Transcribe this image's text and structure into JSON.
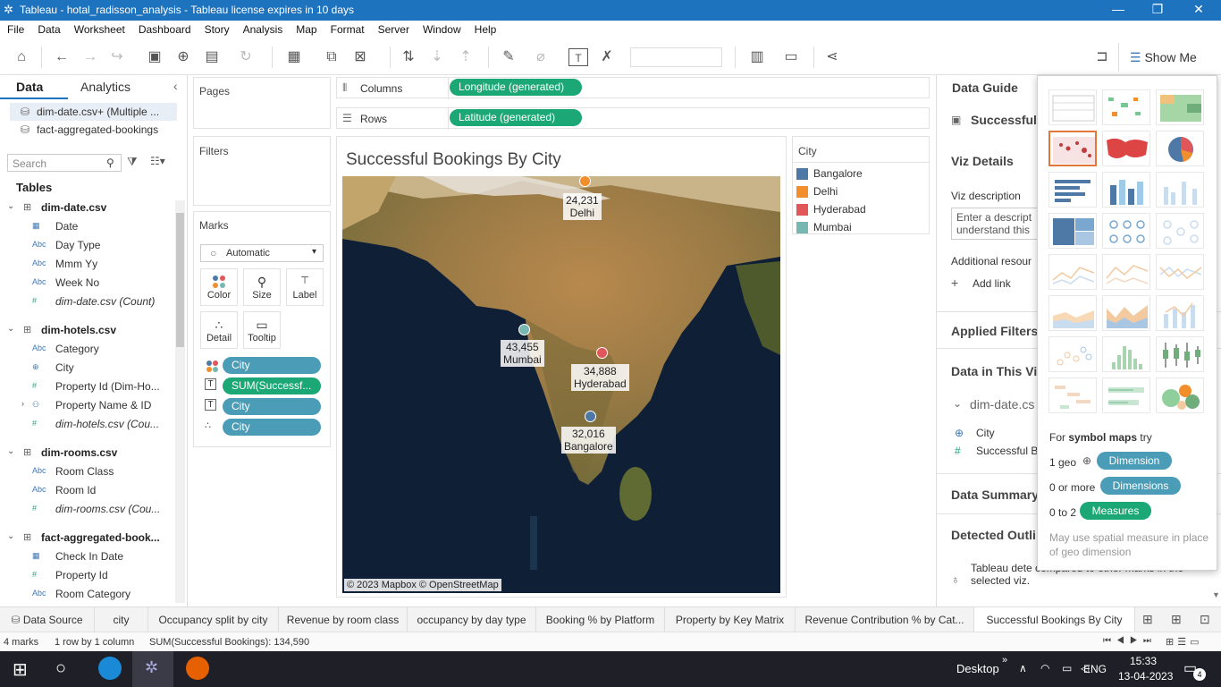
{
  "window": {
    "title": "Tableau - hotal_radisson_analysis - Tableau license expires in 10 days"
  },
  "menu": [
    "File",
    "Data",
    "Worksheet",
    "Dashboard",
    "Story",
    "Analysis",
    "Map",
    "Format",
    "Server",
    "Window",
    "Help"
  ],
  "toolbar": {
    "show_me": "Show Me"
  },
  "left": {
    "tab_data": "Data",
    "tab_analytics": "Analytics",
    "sources": [
      "dim-date.csv+ (Multiple ...",
      "fact-aggregated-bookings"
    ],
    "search_placeholder": "Search",
    "tables_label": "Tables",
    "tables": [
      {
        "name": "dim-date.csv",
        "fields": [
          {
            "icon": "date",
            "label": "Date"
          },
          {
            "icon": "Abc",
            "label": "Day Type"
          },
          {
            "icon": "Abc",
            "label": "Mmm Yy"
          },
          {
            "icon": "Abc",
            "label": "Week No"
          },
          {
            "icon": "#",
            "label": "dim-date.csv (Count)"
          }
        ]
      },
      {
        "name": "dim-hotels.csv",
        "fields": [
          {
            "icon": "Abc",
            "label": "Category"
          },
          {
            "icon": "geo",
            "label": "City"
          },
          {
            "icon": "#",
            "label": "Property Id (Dim-Ho..."
          },
          {
            "icon": "hier",
            "label": "Property Name & ID"
          },
          {
            "icon": "#",
            "label": "dim-hotels.csv (Cou..."
          }
        ]
      },
      {
        "name": "dim-rooms.csv",
        "fields": [
          {
            "icon": "Abc",
            "label": "Room Class"
          },
          {
            "icon": "Abc",
            "label": "Room Id"
          },
          {
            "icon": "#",
            "label": "dim-rooms.csv (Cou..."
          }
        ]
      },
      {
        "name": "fact-aggregated-book...",
        "fields": [
          {
            "icon": "date",
            "label": "Check In Date"
          },
          {
            "icon": "#",
            "label": "Property Id"
          },
          {
            "icon": "Abc",
            "label": "Room Category"
          }
        ]
      }
    ]
  },
  "shelves": {
    "pages": "Pages",
    "filters": "Filters",
    "marks": "Marks",
    "columns_label": "Columns",
    "rows_label": "Rows",
    "columns_pill": "Longitude (generated)",
    "rows_pill": "Latitude (generated)"
  },
  "marks": {
    "type": "Automatic",
    "buttons": [
      "Color",
      "Size",
      "Label",
      "Detail",
      "Tooltip"
    ],
    "pills": [
      "City",
      "SUM(Successf...",
      "City",
      "City"
    ]
  },
  "viz": {
    "title": "Successful Bookings By City",
    "attribution": "© 2023 Mapbox © OpenStreetMap",
    "points": [
      {
        "city": "Delhi",
        "value": "24,231",
        "color": "#F28E2B"
      },
      {
        "city": "Mumbai",
        "value": "43,455",
        "color": "#76B7B2"
      },
      {
        "city": "Hyderabad",
        "value": "34,888",
        "color": "#E15759"
      },
      {
        "city": "Bangalore",
        "value": "32,016",
        "color": "#4E79A7"
      }
    ]
  },
  "legend": {
    "title": "City",
    "items": [
      {
        "label": "Bangalore",
        "color": "#4E79A7"
      },
      {
        "label": "Delhi",
        "color": "#F28E2B"
      },
      {
        "label": "Hyderabad",
        "color": "#E15759"
      },
      {
        "label": "Mumbai",
        "color": "#76B7B2"
      }
    ]
  },
  "guide": {
    "title": "Data Guide",
    "sheet": "Successful",
    "viz_details": "Viz Details",
    "viz_desc_label": "Viz description",
    "viz_desc_text": "Enter a descript understand this",
    "additional": "Additional resour",
    "add_link": "Add link",
    "applied_filters": "Applied Filters",
    "data_in": "Data in This Vi",
    "source": "dim-date.cs",
    "fields": [
      "City",
      "Successful B"
    ],
    "summary": "Data Summary",
    "outliers": "Detected Outli",
    "outlier_text": "Tableau dete compared to other marks in the selected viz."
  },
  "showme": {
    "for_text": "For",
    "bold": "symbol maps",
    "try": "try",
    "rows": [
      {
        "pre": "1 geo",
        "pill": "Dimension",
        "color": "#4B9CB6"
      },
      {
        "pre": "0 or more",
        "pill": "Dimensions",
        "color": "#4B9CB6"
      },
      {
        "pre": "0 to 2",
        "pill": "Measures",
        "color": "#1BA876"
      }
    ],
    "note": "May use spatial measure in place of geo dimension"
  },
  "tabs": [
    "Data Source",
    "city",
    "Occupancy split by city",
    "Revenue by room class",
    "occupancy by day type",
    "Booking % by Platform",
    "Property by Key Matrix",
    "Revenue Contribution % by Cat...",
    "Successful Bookings By City"
  ],
  "status": {
    "marks": "4 marks",
    "rows": "1 row by 1 column",
    "sum": "SUM(Successful Bookings): 134,590"
  },
  "taskbar": {
    "desktop": "Desktop",
    "lang": "ENG",
    "time": "15:33",
    "date": "13-04-2023",
    "notif": "4"
  }
}
